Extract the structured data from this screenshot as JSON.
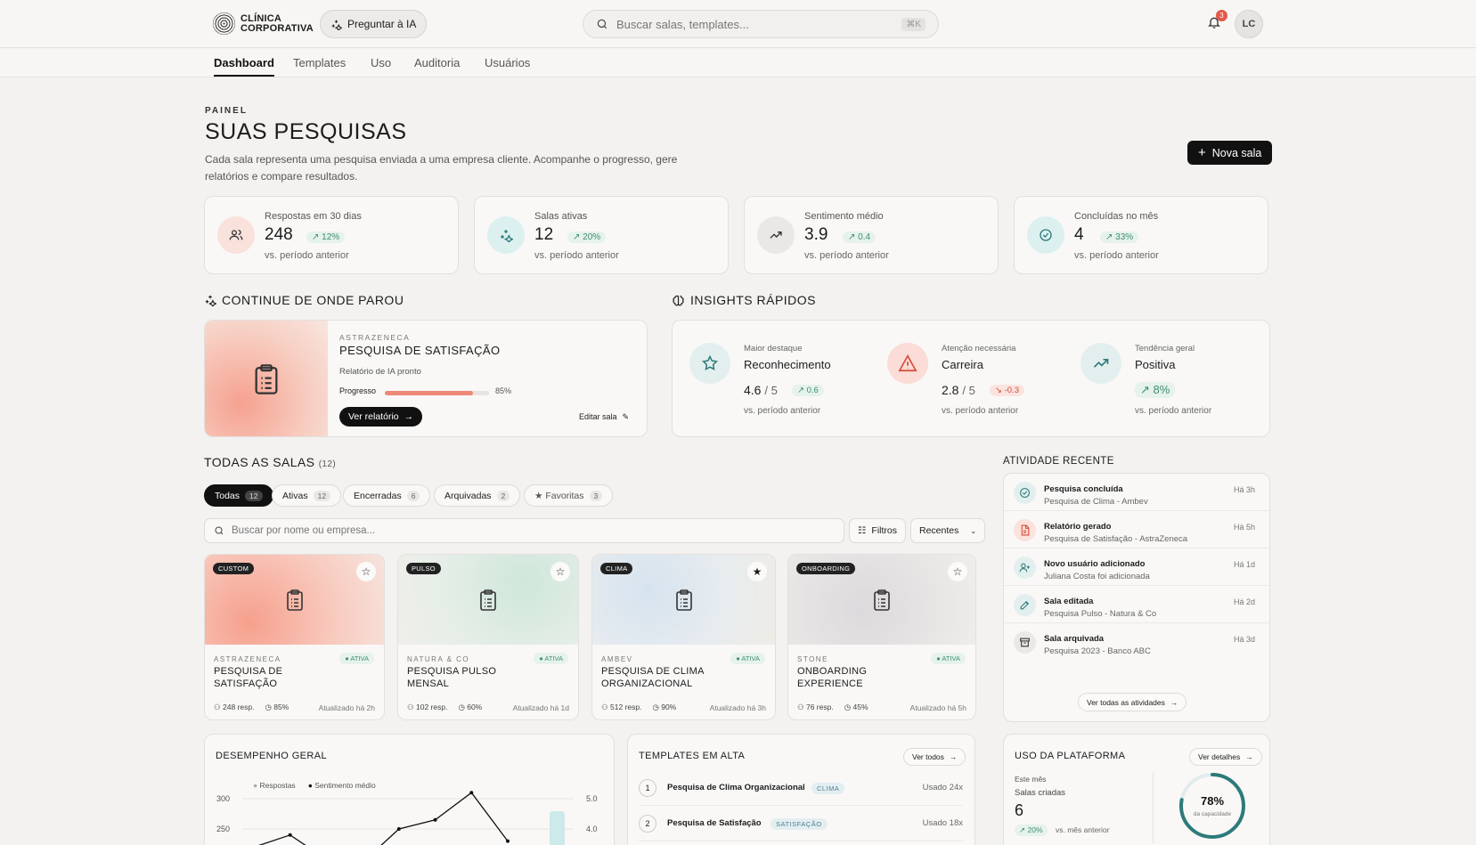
{
  "brand": {
    "line1": "CLÍNICA",
    "line2": "CORPORATIVA"
  },
  "header": {
    "ask_ai": "Preguntar à IA",
    "search_placeholder": "Buscar salas, templates...",
    "search_shortcut": "⌘K",
    "notifications": "3",
    "avatar_initials": "LC"
  },
  "nav": [
    "Dashboard",
    "Templates",
    "Uso",
    "Auditoria",
    "Usuários"
  ],
  "page": {
    "eyebrow": "PAINEL",
    "title": "SUAS PESQUISAS",
    "description": "Cada sala representa uma pesquisa enviada a uma empresa cliente. Acompanhe o progresso, gere relatórios e compare resultados.",
    "new_button": "Nova sala"
  },
  "stats": [
    {
      "label": "Respostas em 30 dias",
      "value": "248",
      "change": "12%",
      "sub": "vs. período anterior",
      "icon": "users-icon",
      "color": "#f9e1dc"
    },
    {
      "label": "Salas ativas",
      "value": "12",
      "change": "20%",
      "sub": "vs. período anterior",
      "icon": "sparkles-icon",
      "color": "#dcf0f0"
    },
    {
      "label": "Sentimento médio",
      "value": "3.9",
      "change": "0.4",
      "sub": "vs. período anterior",
      "icon": "trending-up-icon",
      "color": "#eae8e6"
    },
    {
      "label": "Concluídas no mês",
      "value": "4",
      "change": "33%",
      "sub": "vs. período anterior",
      "icon": "check-circle-icon",
      "color": "#dcf0f0"
    }
  ],
  "continue": {
    "section_title": "CONTINUE DE ONDE PAROU",
    "company": "ASTRAZENECA",
    "title": "PESQUISA DE SATISFAÇÃO",
    "status": "Relatório de IA pronto",
    "progress_label": "Progresso",
    "progress": 85,
    "progress_text": "85%",
    "primary": "Ver relatório",
    "secondary": "Editar sala"
  },
  "insights": {
    "section_title": "INSIGHTS RÁPIDOS",
    "items": [
      {
        "label": "Maior destaque",
        "name": "Reconhecimento",
        "score": "4.6",
        "max": "/ 5",
        "change": "0.6",
        "direction": "up",
        "sub": "vs. período anterior",
        "icon": "star-icon",
        "color": "#e3efef"
      },
      {
        "label": "Atenção necessária",
        "name": "Carreira",
        "score": "2.8",
        "max": "/ 5",
        "change": "-0.3",
        "direction": "down",
        "sub": "vs. período anterior",
        "icon": "alert-triangle-icon",
        "color": "#fbdcd6"
      },
      {
        "label": "Tendência geral",
        "name": "Positiva",
        "score": "",
        "max": "",
        "change": "8%",
        "direction": "up",
        "sub": "vs. período anterior",
        "icon": "trending-up-icon",
        "color": "#e3efef"
      }
    ]
  },
  "rooms_section": {
    "title": "TODAS AS SALAS",
    "count": "(12)",
    "filters": [
      {
        "label": "Todas",
        "count": "12"
      },
      {
        "label": "Ativas",
        "count": "12"
      },
      {
        "label": "Encerradas",
        "count": "6"
      },
      {
        "label": "Arquivadas",
        "count": "2"
      },
      {
        "label": "★ Favoritas",
        "count": "3"
      }
    ],
    "search_placeholder": "Buscar por nome ou empresa...",
    "filter_button": "Filtros",
    "sort": "Recentes"
  },
  "rooms": [
    {
      "tag": "CUSTOM",
      "company": "ASTRAZENECA",
      "status": "● ATIVA",
      "title": "PESQUISA DE SATISFAÇÃO",
      "responses": "248 resp.",
      "progress": "85%",
      "updated": "Atualizado há 2h",
      "favorite": false,
      "gradient": "radial-gradient(circle at 25% 75%,#f6a08d,#f8c9bd 55%,#f6e4de)"
    },
    {
      "tag": "PULSO",
      "company": "NATURA & CO",
      "status": "● ATIVA",
      "title": "PESQUISA PULSO MENSAL",
      "responses": "102 resp.",
      "progress": "60%",
      "updated": "Atualizado há 1d",
      "favorite": false,
      "gradient": "radial-gradient(circle at 70% 30%,#cfe7da,#e6eee7 60%,#f1eeea)"
    },
    {
      "tag": "CLIMA",
      "company": "AMBEV",
      "status": "● ATIVA",
      "title": "PESQUISA DE CLIMA ORGANIZACIONAL",
      "responses": "512 resp.",
      "progress": "90%",
      "updated": "Atualizado há 3h",
      "favorite": true,
      "gradient": "radial-gradient(circle at 30% 40%,#d6e3ef,#e7ecef 55%,#efece6)"
    },
    {
      "tag": "ONBOARDING",
      "company": "STONE",
      "status": "● ATIVA",
      "title": "ONBOARDING EXPERIENCE",
      "responses": "76 resp.",
      "progress": "45%",
      "updated": "Atualizado há 5h",
      "favorite": false,
      "gradient": "radial-gradient(circle at 40% 60%,#dcdadc,#e8e5e5 60%,#f0eeec)"
    }
  ],
  "activity": {
    "title": "ATIVIDADE RECENTE",
    "items": [
      {
        "title": "Pesquisa concluída",
        "sub": "Pesquisa de Clima - Ambev",
        "time": "Há 3h",
        "icon": "check-circle-icon",
        "color": "#e3efef"
      },
      {
        "title": "Relatório gerado",
        "sub": "Pesquisa de Satisfação - AstraZeneca",
        "time": "Há 5h",
        "icon": "file-icon",
        "color": "#fbe2dc"
      },
      {
        "title": "Novo usuário adicionado",
        "sub": "Juliana Costa foi adicionada",
        "time": "Há 1d",
        "icon": "user-plus-icon",
        "color": "#e3efef"
      },
      {
        "title": "Sala editada",
        "sub": "Pesquisa Pulso - Natura & Co",
        "time": "Há 2d",
        "icon": "edit-icon",
        "color": "#e3efef"
      },
      {
        "title": "Sala arquivada",
        "sub": "Pesquisa 2023 - Banco ABC",
        "time": "Há 3d",
        "icon": "archive-icon",
        "color": "#eae8e6"
      }
    ],
    "view_all": "Ver todas as atividades"
  },
  "performance": {
    "title": "DESEMPENHO GERAL",
    "legend": [
      "Respostas",
      "Sentimento médio"
    ]
  },
  "chart_data": {
    "type": "line",
    "title": "DESEMPENHO GERAL",
    "series": [
      {
        "name": "Respostas",
        "values": [
          220,
          240,
          200,
          195,
          250,
          265,
          310,
          230
        ]
      },
      {
        "name": "Sentimento médio",
        "values": []
      }
    ],
    "y_left_ticks": [
      "300",
      "250"
    ],
    "y_right_ticks": [
      "5.0",
      "4.0"
    ]
  },
  "templates": {
    "title": "TEMPLATES EM ALTA",
    "view_all": "Ver todos",
    "items": [
      {
        "rank": "1",
        "name": "Pesquisa de Clima Organizacional",
        "category": "CLIMA",
        "usage": "Usado 24x"
      },
      {
        "rank": "2",
        "name": "Pesquisa de Satisfação",
        "category": "SATISFAÇÃO",
        "usage": "Usado 18x"
      }
    ]
  },
  "usage": {
    "title": "USO DA PLATAFORMA",
    "details": "Ver detalhes",
    "period": "Este mês",
    "metric_label": "Salas criadas",
    "metric_value": "6",
    "change": "20%",
    "change_sub": "vs. mês anterior",
    "capacity": 78,
    "capacity_text": "78%",
    "capacity_label": "da capacidade"
  }
}
